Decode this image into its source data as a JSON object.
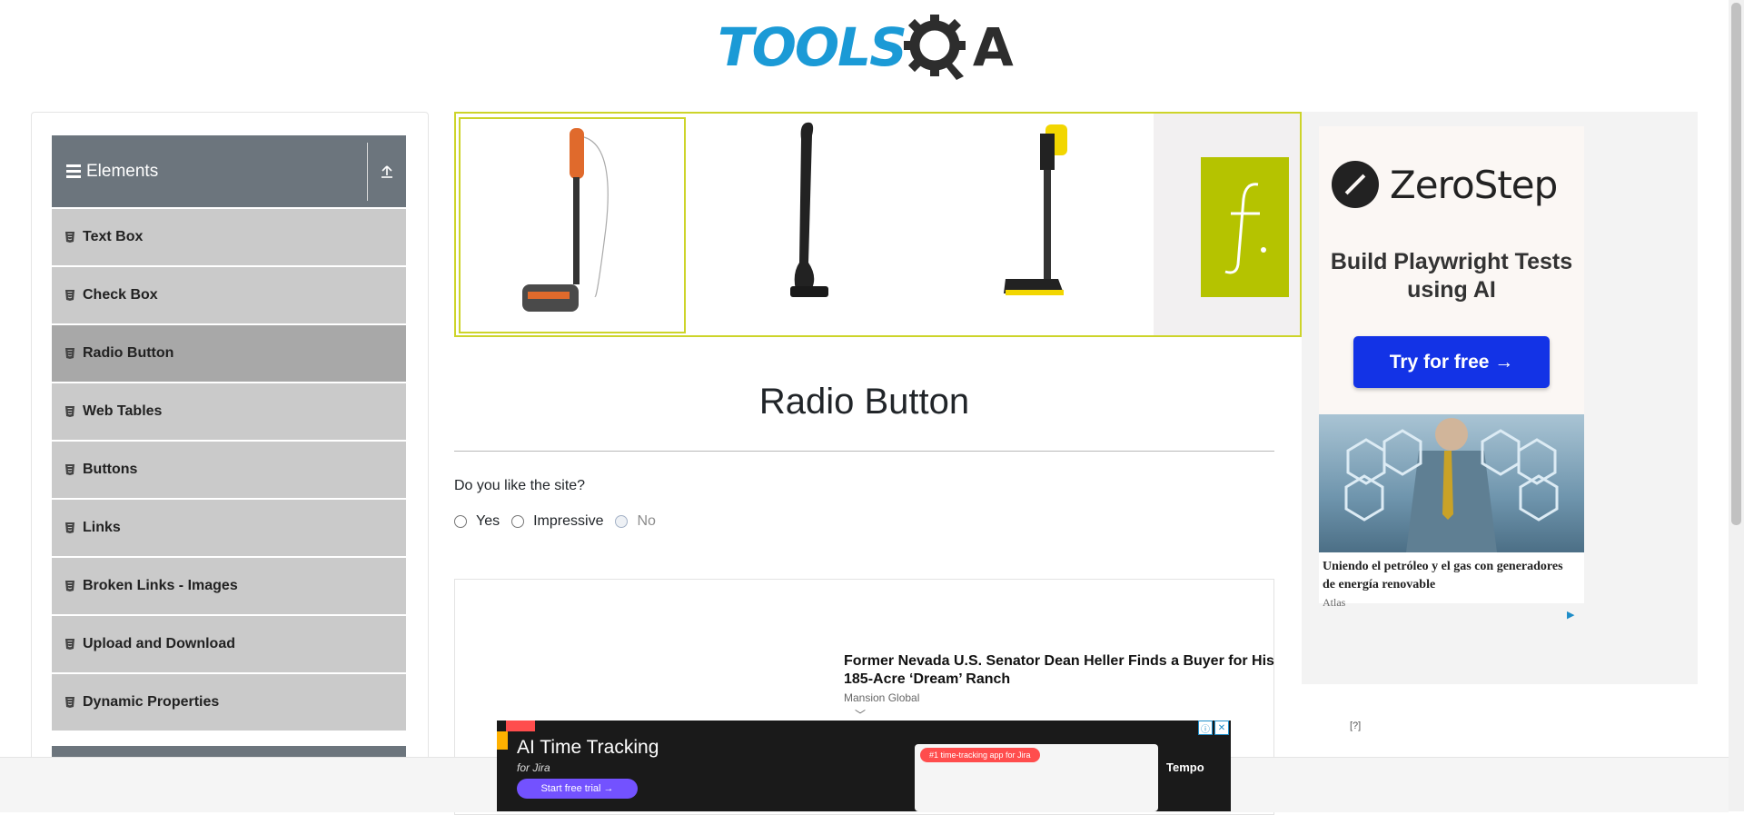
{
  "header": {
    "logo_text_main": "TOOLS",
    "logo_text_end": "A"
  },
  "sidebar": {
    "group_title": "Elements",
    "items": [
      {
        "label": "Text Box",
        "active": false
      },
      {
        "label": "Check Box",
        "active": false
      },
      {
        "label": "Radio Button",
        "active": true
      },
      {
        "label": "Web Tables",
        "active": false
      },
      {
        "label": "Buttons",
        "active": false
      },
      {
        "label": "Links",
        "active": false
      },
      {
        "label": "Broken Links - Images",
        "active": false
      },
      {
        "label": "Upload and Download",
        "active": false
      },
      {
        "label": "Dynamic Properties",
        "active": false
      }
    ]
  },
  "main": {
    "title": "Radio Button",
    "question": "Do you like the site?",
    "options": [
      {
        "label": "Yes",
        "enabled": true
      },
      {
        "label": "Impressive",
        "enabled": true
      },
      {
        "label": "No",
        "enabled": false
      }
    ]
  },
  "article_ad": {
    "headline": "Former Nevada U.S. Senator Dean Heller Finds a Buyer for His 185-Acre ‘Dream’ Ranch",
    "source": "Mansion Global"
  },
  "right_ad": {
    "brand": "ZeroStep",
    "subtitle": "Build Playwright Tests using AI",
    "cta": "Try for free →",
    "caption": "Uniendo el petróleo y el gas con generadores de energía renovable",
    "caption_source": "Atlas",
    "adchoices": "[?]"
  },
  "bottom_ad": {
    "title": "AI Time Tracking",
    "subtitle": "for Jira",
    "cta": "Start free trial →",
    "pill": "#1 time-tracking app for Jira",
    "brand": "Tempo"
  },
  "colors": {
    "sidebar_header": "#6c757d",
    "menu_item": "#cacaca",
    "menu_item_active": "#a8a8a8",
    "banner_border": "#cdd42a",
    "zerostep_button": "#1333e6"
  }
}
